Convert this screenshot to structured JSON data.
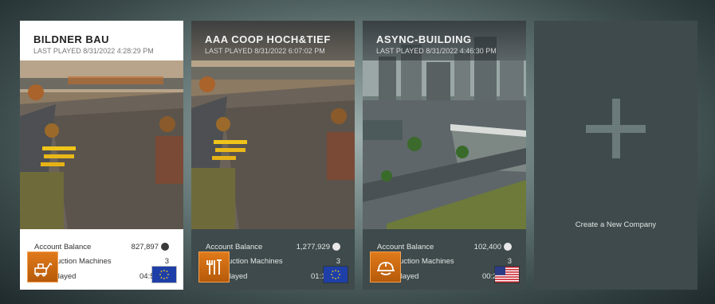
{
  "companies": [
    {
      "name": "BILDNER BAU",
      "last_played": "LAST PLAYED 8/31/2022 4:28:29 PM",
      "sector_icon": "construction-machinery-icon",
      "region_flag": "eu-flag-icon",
      "stats": {
        "account_balance_label": "Account Balance",
        "account_balance_value": "827,897",
        "construction_machines_label": "Construction Machines",
        "construction_machines_value": "3",
        "time_played_label": "Time Played",
        "time_played_value": "04:56:59"
      }
    },
    {
      "name": "AAA COOP HOCH&TIEF",
      "last_played": "LAST PLAYED 8/31/2022 6:07:02 PM",
      "sector_icon": "tools-icon",
      "region_flag": "eu-flag-icon",
      "stats": {
        "account_balance_label": "Account Balance",
        "account_balance_value": "1,277,929",
        "construction_machines_label": "Construction Machines",
        "construction_machines_value": "3",
        "time_played_label": "Time Played",
        "time_played_value": "01:15:08"
      }
    },
    {
      "name": "ASYNC-BUILDING",
      "last_played": "LAST PLAYED 8/31/2022 4:46:30 PM",
      "sector_icon": "hard-hat-icon",
      "region_flag": "us-flag-icon",
      "stats": {
        "account_balance_label": "Account Balance",
        "account_balance_value": "102,400",
        "construction_machines_label": "Construction Machines",
        "construction_machines_value": "3",
        "time_played_label": "Time Played",
        "time_played_value": "00:21:19"
      }
    }
  ],
  "create_card": {
    "label": "Create a New Company",
    "icon": "plus-icon"
  },
  "colors": {
    "sector_orange": "#e07a1a",
    "card_dark": "#3e4a4b",
    "card_selected": "#ffffff"
  }
}
